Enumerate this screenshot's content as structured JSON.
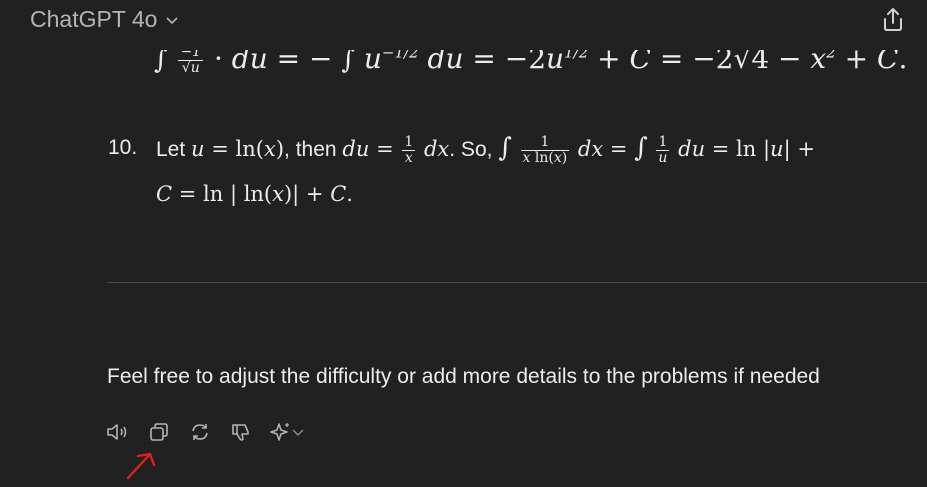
{
  "header": {
    "model_name": "ChatGPT 4o"
  },
  "content": {
    "prev_line_visible": "∫ (−1)/√u · du = − ∫ u^(−1/2) du = −2u^(1/2) + C = −2√(4 − x²) + C.",
    "item10": {
      "number": "10.",
      "let": "Let",
      "then": ", then",
      "so": ". So,"
    },
    "closing_text": "Feel free to adjust the difficulty or add more details to the problems if needed"
  },
  "actions": {
    "read_aloud": "read-aloud-icon",
    "copy": "copy-icon",
    "regenerate": "regenerate-icon",
    "dislike": "thumbs-down-icon",
    "switch_model": "sparkle-icon"
  },
  "colors": {
    "background": "#212121",
    "text": "#ececec",
    "muted": "#b4b4b4",
    "annotation": "#e02020"
  }
}
